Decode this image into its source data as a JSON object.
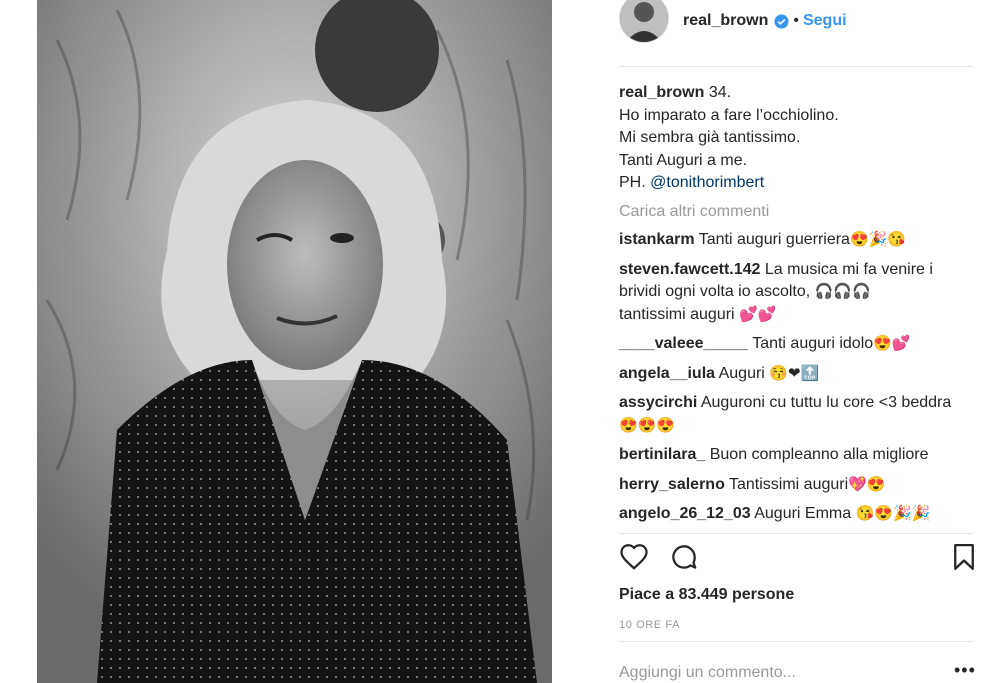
{
  "post": {
    "username": "real_brown",
    "follow_label": "Segui",
    "separator": "•"
  },
  "caption": {
    "username": "real_brown",
    "lines": [
      "34.",
      "Ho imparato a fare l’occhiolino.",
      "Mi sembra già tantissimo.",
      "Tanti Auguri a me."
    ],
    "credit_prefix": "PH.",
    "credit_link": "@tonithorimbert"
  },
  "load_more": "Carica altri commenti",
  "comments": [
    {
      "user": "istankarm",
      "text": "Tanti auguri guerriera",
      "emoji": "😍🎉😘"
    },
    {
      "user": "steven.fawcett.142",
      "text": "La musica mi fa venire i brividi ogni volta io ascolto,",
      "emoji": "🎧🎧🎧",
      "text2": "tantissimi auguri",
      "emoji2": "💕💕"
    },
    {
      "user": "____valeee_____",
      "text": "Tanti auguri idolo",
      "emoji": "😍💕"
    },
    {
      "user": "angela__iula",
      "text": "Auguri",
      "emoji": "😚❤🔝"
    },
    {
      "user": "assycirchi",
      "text": "Auguroni cu tuttu lu core <3 beddra",
      "emoji": "😍😍😍"
    },
    {
      "user": "bertinilara_",
      "text": "Buon compleanno alla migliore",
      "emoji": ""
    },
    {
      "user": "herry_salerno",
      "text": "Tantissimi auguri",
      "emoji": "💖😍"
    },
    {
      "user": "angelo_26_12_03",
      "text": "Auguri Emma",
      "emoji": "😘😍🎉🎉"
    }
  ],
  "likes": "Piace a 83.449 persone",
  "time": "10 ORE FA",
  "add_comment_placeholder": "Aggiungi un commento...",
  "more_label": "•••",
  "icons": {
    "like": "heart-icon",
    "comment": "comment-icon",
    "save": "bookmark-icon",
    "verified": "verified-badge-icon"
  },
  "colors": {
    "link": "#3897f0",
    "muted": "#999999",
    "text": "#262626"
  }
}
